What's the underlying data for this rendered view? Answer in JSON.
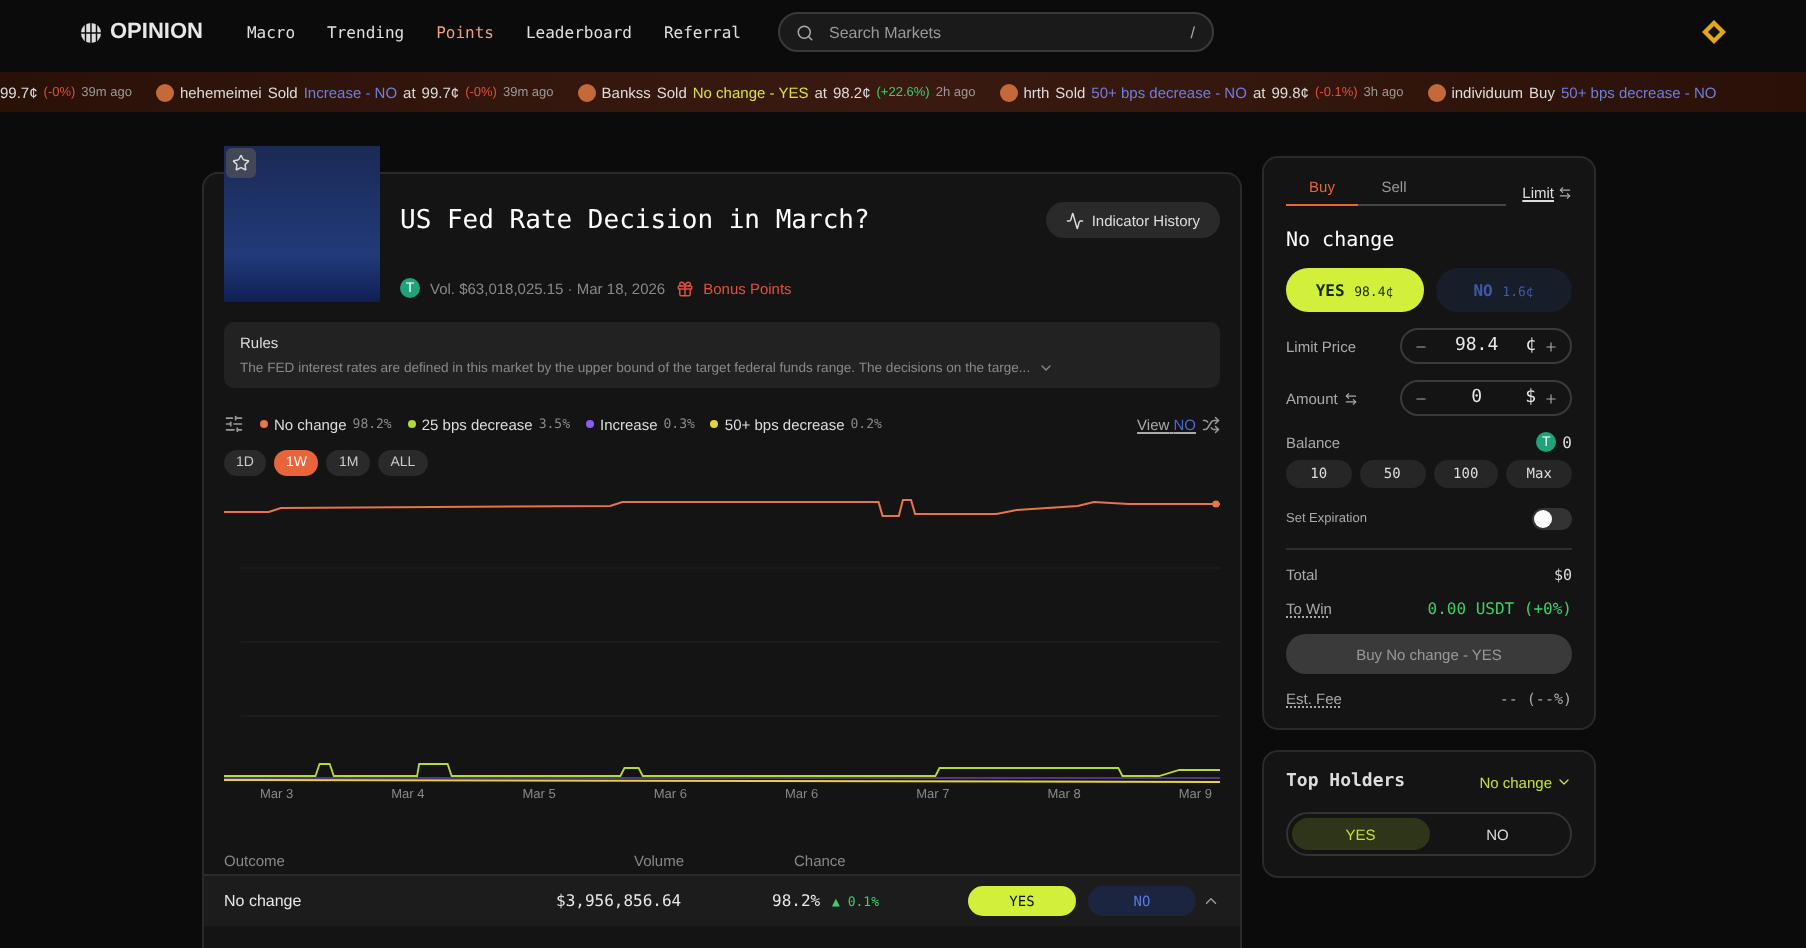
{
  "header": {
    "logo": "OPINION",
    "nav": [
      {
        "label": "Macro",
        "selected": false
      },
      {
        "label": "Trending",
        "selected": false
      },
      {
        "label": "Points",
        "selected": true
      },
      {
        "label": "Leaderboard",
        "selected": false
      },
      {
        "label": "Referral",
        "selected": false
      }
    ],
    "search": {
      "placeholder": "Search Markets",
      "shortcut": "/"
    }
  },
  "ticker": [
    {
      "price": "99.7¢",
      "change": {
        "text": "(-0%)",
        "color": "#e0503a"
      },
      "time": "39m ago"
    },
    {
      "user": "hehemeimei",
      "action": "Sold",
      "outcome": "Increase - NO",
      "color": "#6f7fe0",
      "at": "at",
      "price": "99.7¢",
      "change": {
        "text": "(-0%)",
        "color": "#e0503a"
      },
      "time": "39m ago"
    },
    {
      "user": "Bankss",
      "action": "Sold",
      "outcome": "No change - YES",
      "color": "#d6e04a",
      "at": "at",
      "price": "98.2¢",
      "change": {
        "text": "(+22.6%)",
        "color": "#3ad06a"
      },
      "time": "2h ago"
    },
    {
      "user": "hrth",
      "action": "Sold",
      "outcome": "50+ bps decrease - NO",
      "color": "#6f7fe0",
      "at": "at",
      "price": "99.8¢",
      "change": {
        "text": "(-0.1%)",
        "color": "#e0503a"
      },
      "time": "3h ago"
    },
    {
      "user": "individuum",
      "action": "Buy",
      "outcome": "50+ bps decrease - NO",
      "color": "#6f7fe0"
    }
  ],
  "market": {
    "title": "US Fed Rate Decision in March?",
    "starred": false,
    "token": "T",
    "volume": "Vol. $63,018,025.15 · Mar 18, 2026",
    "bonus": "Bonus Points",
    "history_button": "Indicator History",
    "rules": {
      "title": "Rules",
      "text": "The FED interest rates are defined in this market by the upper bound of the target federal funds range. The decisions on the targe..."
    }
  },
  "legend": [
    {
      "name": "No change",
      "value": "98.2%",
      "color": "#e8744a"
    },
    {
      "name": "25 bps decrease",
      "value": "3.5%",
      "color": "#b5d93a"
    },
    {
      "name": "Increase",
      "value": "0.3%",
      "color": "#8a5cf0"
    },
    {
      "name": "50+ bps decrease",
      "value": "0.2%",
      "color": "#e8d43a"
    }
  ],
  "view": {
    "label": "View",
    "side": "NO"
  },
  "ranges": [
    {
      "label": "1D",
      "selected": false
    },
    {
      "label": "1W",
      "selected": true
    },
    {
      "label": "1M",
      "selected": false
    },
    {
      "label": "ALL",
      "selected": false
    }
  ],
  "chart": {
    "x_labels": [
      "Mar 3",
      "Mar 4",
      "Mar 5",
      "Mar 6",
      "Mar 6",
      "Mar 7",
      "Mar 8",
      "Mar 9"
    ]
  },
  "table": {
    "columns": [
      "Outcome",
      "Volume",
      "Chance"
    ],
    "rows": [
      {
        "outcome": "No change",
        "volume": "$3,956,856.64",
        "chance": "98.2%",
        "delta": "▲ 0.1%",
        "yes": "YES",
        "no": "NO",
        "expanded": true
      }
    ]
  },
  "trade": {
    "tabs": [
      {
        "label": "Buy",
        "selected": true
      },
      {
        "label": "Sell",
        "selected": false
      }
    ],
    "mode": "Limit",
    "outcome": "No change",
    "sides": [
      {
        "label": "YES",
        "price": "98.4¢",
        "selected": true,
        "kind": "yes"
      },
      {
        "label": "NO",
        "price": "1.6¢",
        "selected": false,
        "kind": "no"
      }
    ],
    "limit_price": {
      "label": "Limit Price",
      "value": "98.4",
      "unit": "¢"
    },
    "amount": {
      "label": "Amount",
      "value": "0",
      "unit": "$"
    },
    "balance": {
      "label": "Balance",
      "token": "T",
      "value": "0"
    },
    "quick": [
      "10",
      "50",
      "100",
      "Max"
    ],
    "expiration": {
      "label": "Set Expiration",
      "on": false
    },
    "total": {
      "label": "Total",
      "value": "$0"
    },
    "to_win": {
      "label": "To Win",
      "value": "0.00 USDT (+0%)"
    },
    "submit": "Buy No change - YES",
    "fee": {
      "label": "Est. Fee",
      "value": "-- (--%)"
    }
  },
  "holders": {
    "title": "Top Holders",
    "filter": "No change",
    "tabs": [
      {
        "label": "YES",
        "selected": true
      },
      {
        "label": "NO",
        "selected": false
      }
    ]
  }
}
